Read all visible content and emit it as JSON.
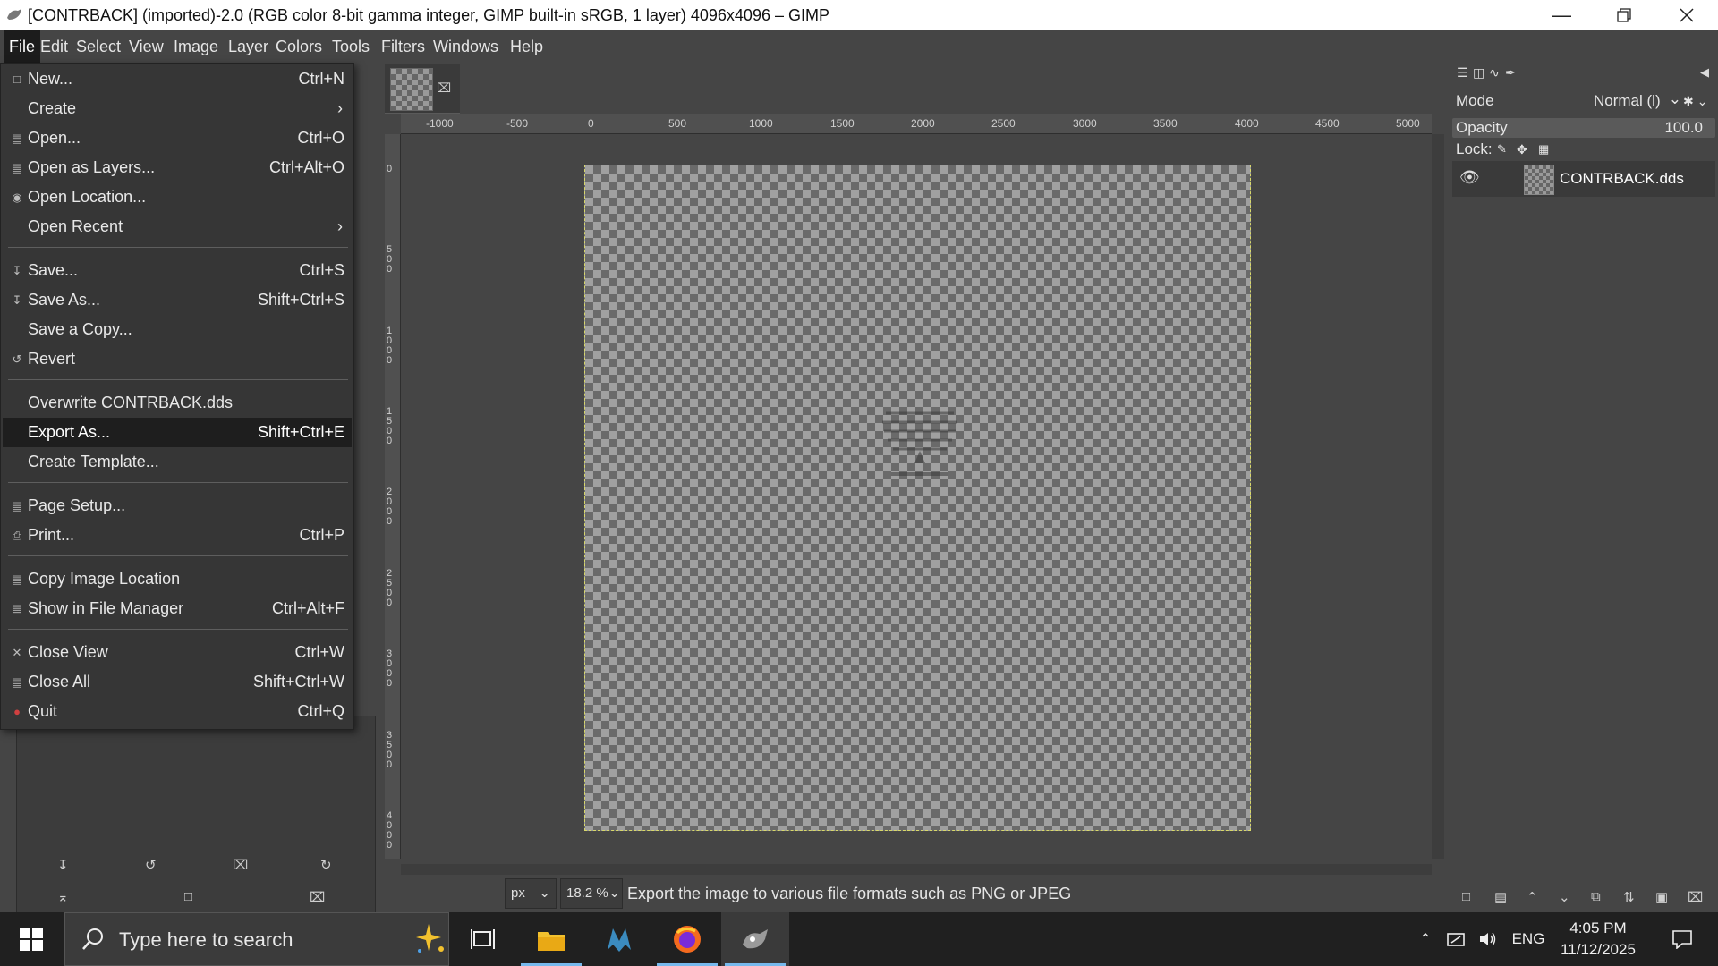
{
  "window": {
    "title": "[CONTRBACK] (imported)-2.0 (RGB color 8-bit gamma integer, GIMP built-in sRGB, 1 layer) 4096x4096 – GIMP"
  },
  "menubar": [
    "File",
    "Edit",
    "Select",
    "View",
    "Image",
    "Layer",
    "Colors",
    "Tools",
    "Filters",
    "Windows",
    "Help"
  ],
  "file_menu": {
    "items": [
      {
        "label": "New...",
        "shortcut": "Ctrl+N",
        "icon": "new-icon"
      },
      {
        "label": "Create",
        "shortcut": "",
        "icon": "",
        "submenu": true
      },
      {
        "label": "Open...",
        "shortcut": "Ctrl+O",
        "icon": "open-icon"
      },
      {
        "label": "Open as Layers...",
        "shortcut": "Ctrl+Alt+O",
        "icon": "open-layers-icon"
      },
      {
        "label": "Open Location...",
        "shortcut": "",
        "icon": "location-icon"
      },
      {
        "label": "Open Recent",
        "shortcut": "",
        "icon": "",
        "submenu": true
      },
      {
        "label": "Save...",
        "shortcut": "Ctrl+S",
        "icon": "save-icon"
      },
      {
        "label": "Save As...",
        "shortcut": "Shift+Ctrl+S",
        "icon": "save-as-icon"
      },
      {
        "label": "Save a Copy...",
        "shortcut": "",
        "icon": ""
      },
      {
        "label": "Revert",
        "shortcut": "",
        "icon": "revert-icon"
      },
      {
        "label": "Overwrite CONTRBACK.dds",
        "shortcut": "",
        "icon": ""
      },
      {
        "label": "Export As...",
        "shortcut": "Shift+Ctrl+E",
        "icon": "",
        "highlighted": true
      },
      {
        "label": "Create Template...",
        "shortcut": "",
        "icon": ""
      },
      {
        "label": "Page Setup...",
        "shortcut": "",
        "icon": "page-setup-icon"
      },
      {
        "label": "Print...",
        "shortcut": "Ctrl+P",
        "icon": "print-icon"
      },
      {
        "label": "Copy Image Location",
        "shortcut": "",
        "icon": "copy-location-icon"
      },
      {
        "label": "Show in File Manager",
        "shortcut": "Ctrl+Alt+F",
        "icon": "file-manager-icon"
      },
      {
        "label": "Close View",
        "shortcut": "Ctrl+W",
        "icon": "close-icon"
      },
      {
        "label": "Close All",
        "shortcut": "Shift+Ctrl+W",
        "icon": "close-all-icon"
      },
      {
        "label": "Quit",
        "shortcut": "Ctrl+Q",
        "icon": "quit-icon"
      }
    ]
  },
  "rulers": {
    "horizontal": [
      "-1000",
      "-500",
      "0",
      "500",
      "1000",
      "1500",
      "2000",
      "2500",
      "3000",
      "3500",
      "4000",
      "4500",
      "5000"
    ],
    "vertical": [
      "0",
      "500",
      "1000",
      "1500",
      "2000",
      "2500",
      "3000",
      "3500",
      "4000"
    ]
  },
  "status": {
    "unit": "px",
    "zoom": "18.2 %",
    "message": "Export the image to various file formats such as PNG or JPEG"
  },
  "layers_panel": {
    "mode_label": "Mode",
    "mode_value": "Normal (l)",
    "opacity_label": "Opacity",
    "opacity_value": "100.0",
    "lock_label": "Lock:",
    "layers": [
      {
        "name": "CONTRBACK.dds",
        "visible": true
      }
    ]
  },
  "taskbar": {
    "search_placeholder": "Type here to search",
    "language": "ENG",
    "time": "4:05 PM",
    "date": "11/12/2025"
  },
  "colors": {
    "menu_bg": "#363636",
    "highlight": "#1e1e1e",
    "selection_border": "#d8d86a",
    "taskbar": "#202020",
    "taskbar_accent": "#76b9ed"
  }
}
